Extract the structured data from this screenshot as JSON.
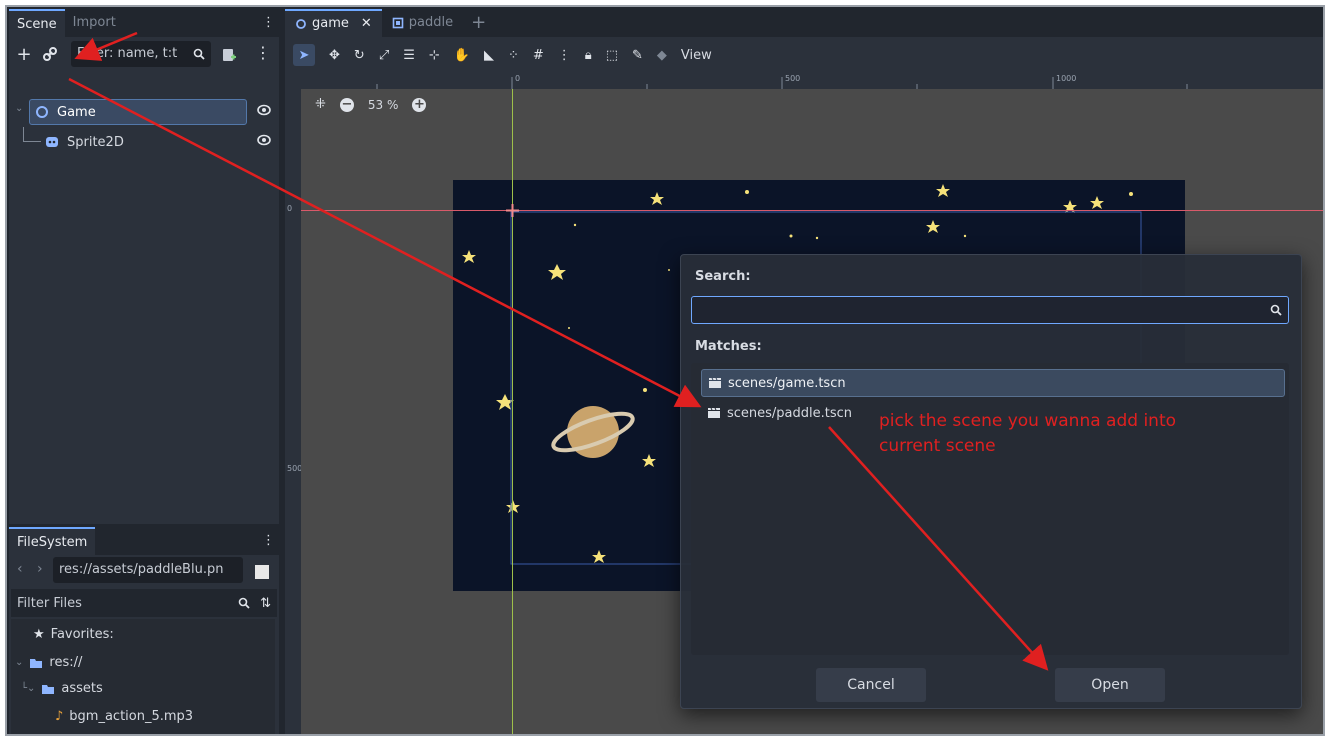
{
  "scene_dock": {
    "tabs": [
      "Scene",
      "Import"
    ],
    "filter_placeholder": "Filter: name, t:t",
    "tree": [
      {
        "label": "Game",
        "icon": "node2d-icon"
      },
      {
        "label": "Sprite2D",
        "icon": "sprite2d-icon"
      }
    ]
  },
  "filesystem_dock": {
    "tab": "FileSystem",
    "path": "res://assets/paddleBlu.pn",
    "filter_placeholder": "Filter Files",
    "items": [
      {
        "label": "Favorites:",
        "icon": "star-icon"
      },
      {
        "label": "res://",
        "icon": "folder-icon"
      },
      {
        "label": "assets",
        "icon": "folder-icon"
      },
      {
        "label": "bgm_action_5.mp3",
        "icon": "audio-icon"
      }
    ]
  },
  "editor": {
    "scene_tabs": [
      "game",
      "paddle"
    ],
    "toolbar_view_label": "View",
    "zoom_label": "53 %",
    "ruler_labels_h": [
      "0",
      "500",
      "1000"
    ],
    "ruler_labels_v": [
      "0",
      "500"
    ]
  },
  "dialog": {
    "search_label": "Search:",
    "search_value": "",
    "matches_label": "Matches:",
    "matches": [
      "scenes/game.tscn",
      "scenes/paddle.tscn"
    ],
    "selected_index": 0,
    "cancel_label": "Cancel",
    "open_label": "Open"
  },
  "annotation": {
    "text_line1": "pick the scene you wanna add into",
    "text_line2": "current scene",
    "color": "#e02020"
  },
  "colors": {
    "accent": "#6fa8ff",
    "panel": "#2b313b",
    "background": "#21262e",
    "viewport": "#4a4a4a",
    "space": "#0b1428"
  }
}
